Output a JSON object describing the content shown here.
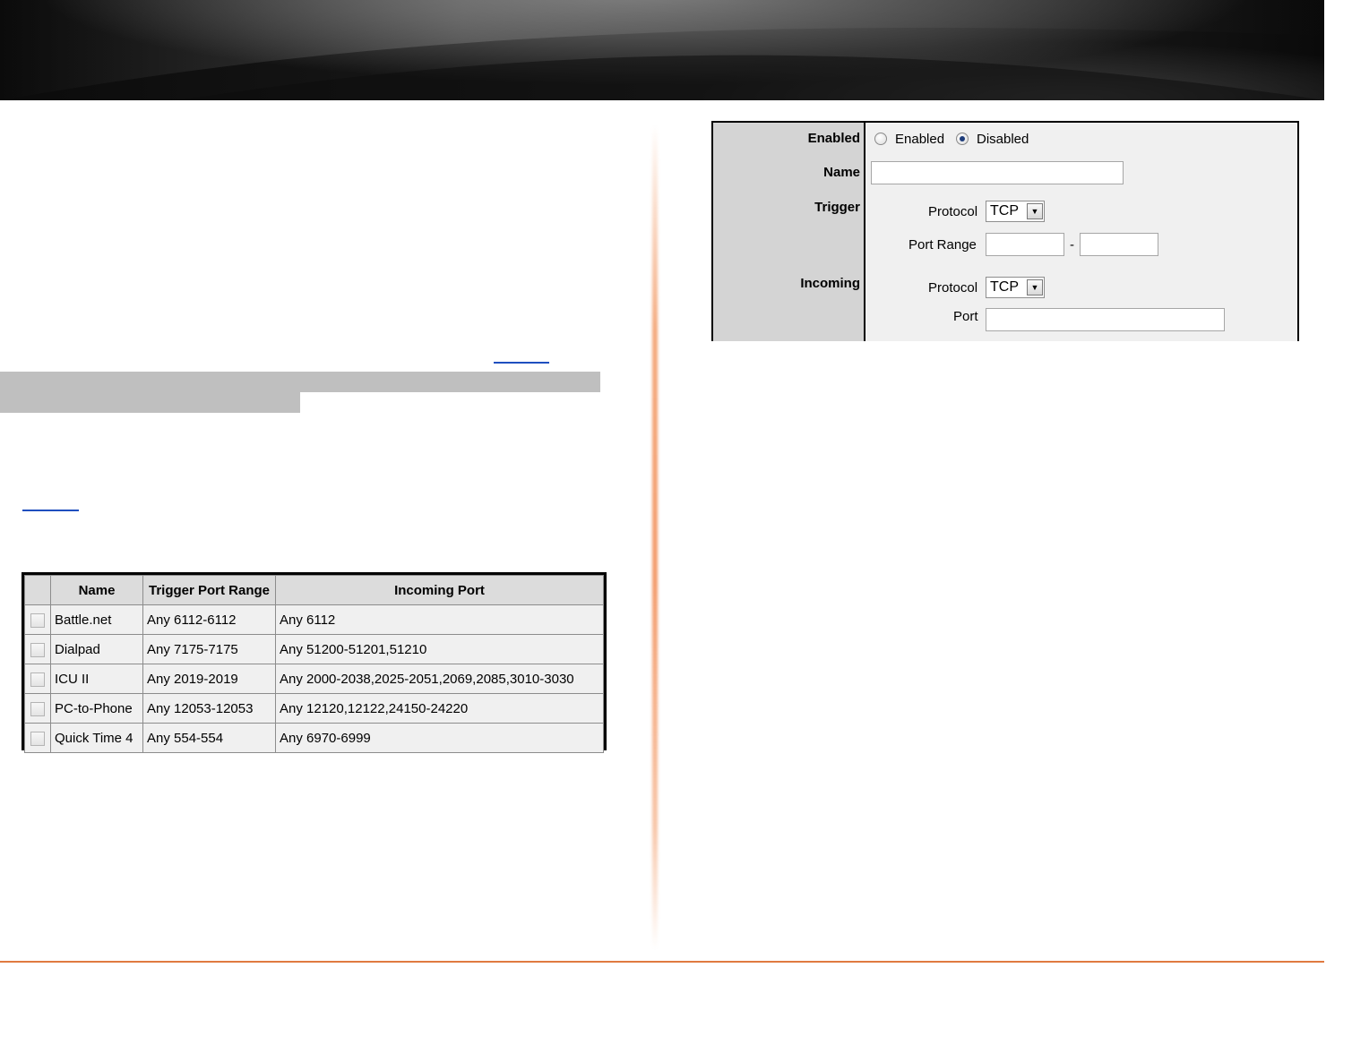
{
  "trigger_list": {
    "headers": {
      "name": "Name",
      "trigger": "Trigger Port Range",
      "incoming": "Incoming Port"
    },
    "rows": [
      {
        "name": "Battle.net",
        "trigger": "Any 6112-6112",
        "incoming": "Any 6112",
        "checked": false
      },
      {
        "name": "Dialpad",
        "trigger": "Any 7175-7175",
        "incoming": "Any 51200-51201,51210",
        "checked": false
      },
      {
        "name": "ICU II",
        "trigger": "Any 2019-2019",
        "incoming": "Any 2000-2038,2025-2051,2069,2085,3010-3030",
        "checked": false
      },
      {
        "name": "PC-to-Phone",
        "trigger": "Any 12053-12053",
        "incoming": "Any 12120,12122,24150-24220",
        "checked": false
      },
      {
        "name": "Quick Time 4",
        "trigger": "Any 554-554",
        "incoming": "Any 6970-6999",
        "checked": false
      }
    ]
  },
  "form": {
    "enabled_label": "Enabled",
    "enabled_option": "Enabled",
    "disabled_option": "Disabled",
    "selected_state": "Disabled",
    "name_label": "Name",
    "name_value": "",
    "trigger_label": "Trigger",
    "trigger_protocol_label": "Protocol",
    "trigger_protocol_value": "TCP",
    "trigger_port_range_label": "Port Range",
    "trigger_port_start": "",
    "trigger_port_end": "",
    "range_separator": "-",
    "incoming_label": "Incoming",
    "incoming_protocol_label": "Protocol",
    "incoming_protocol_value": "TCP",
    "incoming_port_label": "Port",
    "incoming_port_value": ""
  },
  "colors": {
    "accent_orange": "#e07a40",
    "link_blue": "#1f4fbf",
    "label_bg": "#d4d4d4",
    "field_bg": "#f0f0f0"
  }
}
